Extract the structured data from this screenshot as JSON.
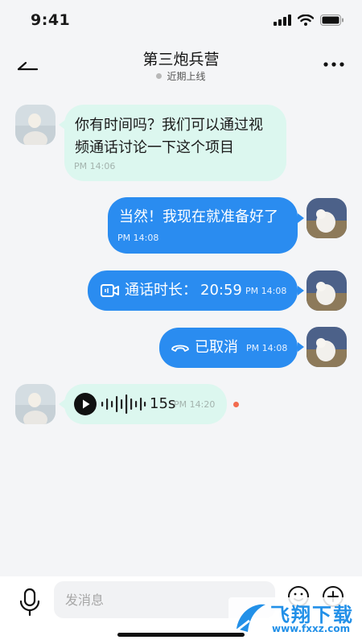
{
  "status_bar": {
    "time": "9:41"
  },
  "header": {
    "title": "第三炮兵营",
    "subtitle": "近期上线"
  },
  "messages": [
    {
      "text_line1": "你有时间吗？我们可以通过视",
      "text_line2": "频通话讨论一下这个项目",
      "time": "PM 14:06"
    },
    {
      "text": "当然！我现在就准备好了",
      "time": "PM 14:08"
    },
    {
      "label": "通话时长：",
      "duration": "20:59",
      "time": "PM 14:08"
    },
    {
      "text": "已取消",
      "time": "PM 14:08"
    },
    {
      "duration": "15s",
      "time": "PM 14:20"
    }
  ],
  "composer": {
    "placeholder": "发消息"
  },
  "watermark": {
    "text": "飞翔下载",
    "url": "www.fxxz.com"
  },
  "colors": {
    "incoming_bubble": "#dcf7ef",
    "outgoing_bubble": "#2a8cf0",
    "unread_dot": "#f26b4f",
    "background": "#f4f5f7"
  }
}
